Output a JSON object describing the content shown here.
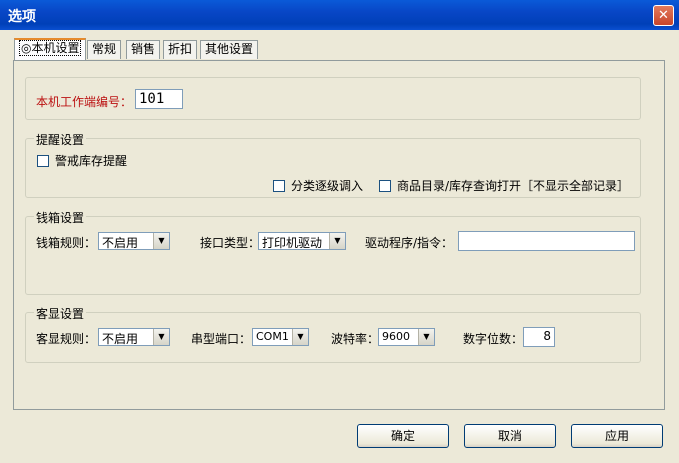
{
  "window": {
    "title": "选项",
    "close_label": "✕"
  },
  "tabs": [
    {
      "label": "◎本机设置",
      "active": true
    },
    {
      "label": "常规"
    },
    {
      "label": "销售"
    },
    {
      "label": "折扣"
    },
    {
      "label": "其他设置"
    }
  ],
  "terminal": {
    "label": "本机工作端编号：",
    "value": "101"
  },
  "reminder": {
    "title": "提醒设置",
    "warn_stock": "警戒库存提醒",
    "category_load": "分类逐级调入",
    "catalog_query": "商品目录/库存查询打开［不显示全部记录］"
  },
  "cashbox": {
    "title": "钱箱设置",
    "rule_label": "钱箱规则：",
    "rule_value": "不启用",
    "port_type_label": "接口类型：",
    "port_type_value": "打印机驱动",
    "driver_label": "驱动程序/指令：",
    "driver_value": ""
  },
  "customer_display": {
    "title": "客显设置",
    "rule_label": "客显规则：",
    "rule_value": "不启用",
    "serial_label": "串型端口：",
    "serial_value": "COM1",
    "baud_label": "波特率：",
    "baud_value": "9600",
    "digits_label": "数字位数：",
    "digits_value": "8"
  },
  "buttons": {
    "ok": "确定",
    "cancel": "取消",
    "apply": "应用"
  },
  "colors": {
    "titlebar": "#0846c6",
    "window_bg": "#ece9d8",
    "accent_tab": "#e68b2c",
    "label_red": "#b11111"
  }
}
